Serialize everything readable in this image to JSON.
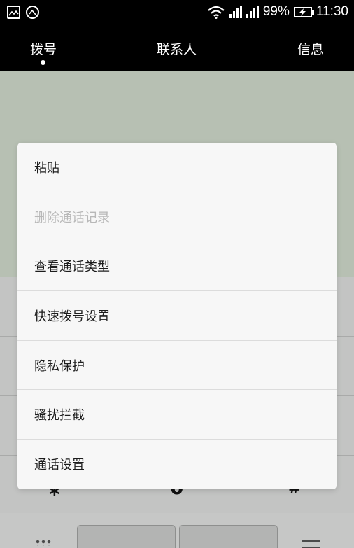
{
  "status_bar": {
    "battery_percent": "99%",
    "time": "11:30",
    "icons": [
      "gallery-icon",
      "sync-icon",
      "wifi-icon",
      "signal-icon",
      "signal-icon",
      "battery-charging-icon"
    ]
  },
  "tabs": [
    {
      "label": "拨号",
      "active": true
    },
    {
      "label": "联系人",
      "active": false
    },
    {
      "label": "信息",
      "active": false
    }
  ],
  "background": {
    "keys": {
      "star": "*",
      "zero": "0",
      "hash": "#"
    }
  },
  "menu": {
    "items": [
      {
        "label": "粘贴",
        "enabled": true
      },
      {
        "label": "删除通话记录",
        "enabled": false
      },
      {
        "label": "查看通话类型",
        "enabled": true
      },
      {
        "label": "快速拨号设置",
        "enabled": true
      },
      {
        "label": "隐私保护",
        "enabled": true
      },
      {
        "label": "骚扰拦截",
        "enabled": true
      },
      {
        "label": "通话设置",
        "enabled": true
      }
    ]
  },
  "colors": {
    "status_bar_bg": "#000000",
    "menu_bg": "#f7f7f7",
    "menu_text": "#1c1c1c",
    "menu_text_disabled": "#b8b8b8",
    "dim_overlay": "#b9bcb9"
  }
}
